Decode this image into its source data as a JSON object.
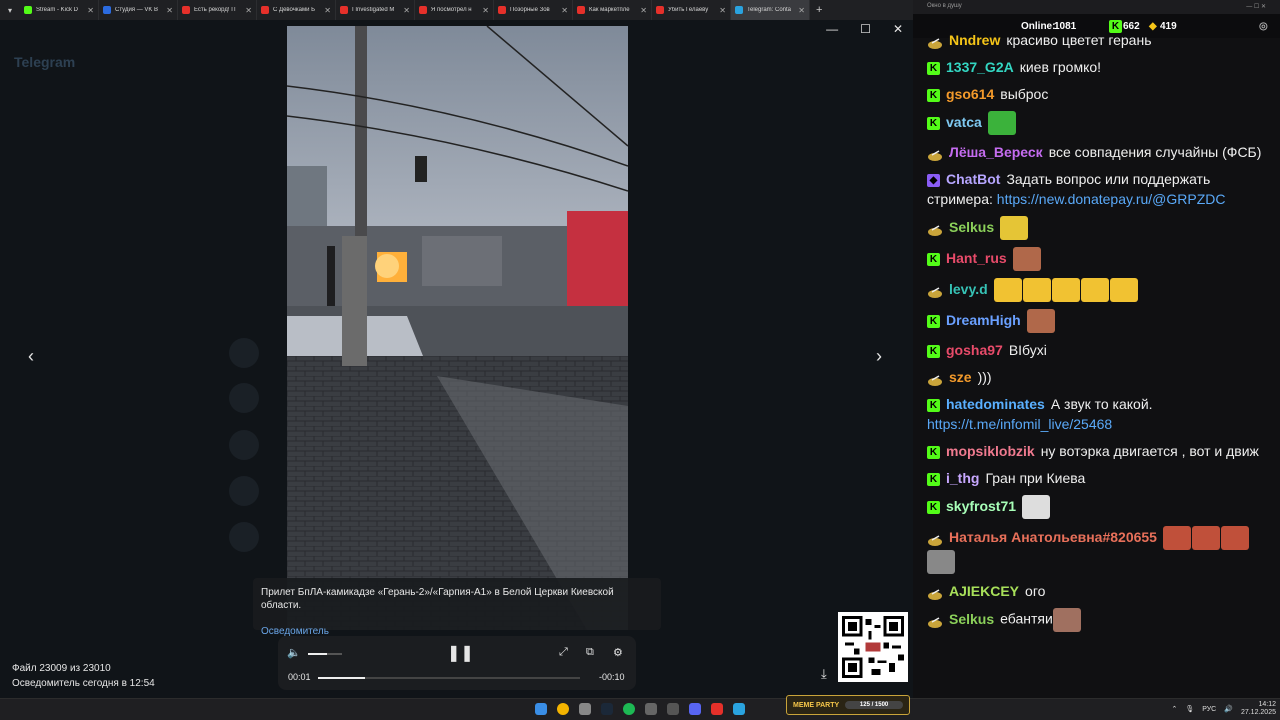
{
  "browser": {
    "tabs": [
      {
        "label": "Stream - Kick D",
        "color": "#53fc18"
      },
      {
        "label": "Студия — VK В",
        "color": "#2b6be0"
      },
      {
        "label": "Есть рекорд! П",
        "color": "#e5302a"
      },
      {
        "label": "С Девочками Б",
        "color": "#e5302a"
      },
      {
        "label": "I Investigated M",
        "color": "#e5302a"
      },
      {
        "label": "Я посмотрел н",
        "color": "#e5302a"
      },
      {
        "label": "Позорные Зов",
        "color": "#e5302a"
      },
      {
        "label": "Как маркетпле",
        "color": "#e5302a"
      },
      {
        "label": "Убить Гелаеву",
        "color": "#e5302a"
      },
      {
        "label": "Telegram: Conta",
        "color": "#2aa3df"
      }
    ]
  },
  "telegram": {
    "logo": "Telegram",
    "caption": "Прилет БпЛА-камикадзе «Герань-2»/«Гарпия-А1» в Белой Церкви Киевской области.",
    "source": "Осведомитель",
    "file_info": "Файл 23009 из 23010",
    "file_meta": "Осведомитель   сегодня в 12:54",
    "time_elapsed": "00:01",
    "time_remaining": "-00:10",
    "volume": 0.55,
    "progress": 0.18
  },
  "chat": {
    "window_title": "Окно в душу",
    "online_label": "Online:",
    "online": "1081",
    "kick_count": "662",
    "other_count": "419",
    "messages": [
      {
        "user": "Nndrew",
        "color": "#f5c518",
        "badge": "gold",
        "text": "красиво цветет герань"
      },
      {
        "user": "1337_G2A",
        "color": "#33d6c2",
        "badge": "kick",
        "text": "киев громко!"
      },
      {
        "user": "gso614",
        "color": "#f39a2b",
        "badge": "kick",
        "text": "выброс"
      },
      {
        "user": "vatca",
        "color": "#7ec8f0",
        "badge": "kick",
        "text": "",
        "emotes": [
          "#3bb23b"
        ]
      },
      {
        "user": "Лёша_Вереск",
        "color": "#c56cf0",
        "badge": "gold",
        "text": "все совпадения случайны (ФСБ)"
      },
      {
        "user": "ChatBot",
        "color": "#b7a6ff",
        "badge": "bot",
        "text": "Задать вопрос или поддержать стримера: ",
        "link": "https://new.donatepay.ru/@GRPZDC"
      },
      {
        "user": "Selkus",
        "color": "#8bd05a",
        "badge": "gold",
        "text": "",
        "emotes": [
          "#e5c536"
        ]
      },
      {
        "user": "Hant_rus",
        "color": "#e84b6a",
        "badge": "kick",
        "text": "",
        "emotes": [
          "#b0684a"
        ]
      },
      {
        "user": "levy.d",
        "color": "#36c2b5",
        "badge": "gold",
        "text": "",
        "emotes": [
          "#f1c232",
          "#f1c232",
          "#f1c232",
          "#f1c232",
          "#f1c232"
        ]
      },
      {
        "user": "DreamHigh",
        "color": "#6aa0ff",
        "badge": "kick",
        "text": "",
        "emotes": [
          "#b0684a"
        ]
      },
      {
        "user": "gosha97",
        "color": "#e84b6a",
        "badge": "kick",
        "text": "ВІбухі"
      },
      {
        "user": "sze",
        "color": "#f39a2b",
        "badge": "gold",
        "text": ")))"
      },
      {
        "user": "hatedominates",
        "color": "#5ab0ff",
        "badge": "kick",
        "text": "А звук то какой. ",
        "link": "https://t.me/infomil_live/25468"
      },
      {
        "user": "mopsiklobzik",
        "color": "#f07a8f",
        "badge": "kick",
        "text": "ну вотэрка двигается , вот и движ"
      },
      {
        "user": "i_thg",
        "color": "#c8a8ff",
        "badge": "kick",
        "text": "Гран при Киева"
      },
      {
        "user": "skyfrost71",
        "color": "#a8ffb8",
        "badge": "kick",
        "text": "",
        "emotes": [
          "#dddddd"
        ]
      },
      {
        "user": "Наталья Анатольевна#820655",
        "color": "#e8705a",
        "badge": "gold",
        "text": "",
        "emotes": [
          "#c0503a",
          "#c0503a",
          "#c0503a",
          "#888888"
        ]
      },
      {
        "user": "AJIEKCEY",
        "color": "#a8e05a",
        "badge": "gold",
        "text": "ого"
      },
      {
        "user": "Selkus",
        "color": "#8bd05a",
        "badge": "gold",
        "text": "ебантяи",
        "emotes_after": [
          "#a07060"
        ]
      }
    ]
  },
  "taskbar": {
    "lang": "РУС",
    "time": "14:12",
    "date": "27.12.2025",
    "memeparty": "MEME PARTY",
    "memeparty_progress": "125 / 1500"
  }
}
